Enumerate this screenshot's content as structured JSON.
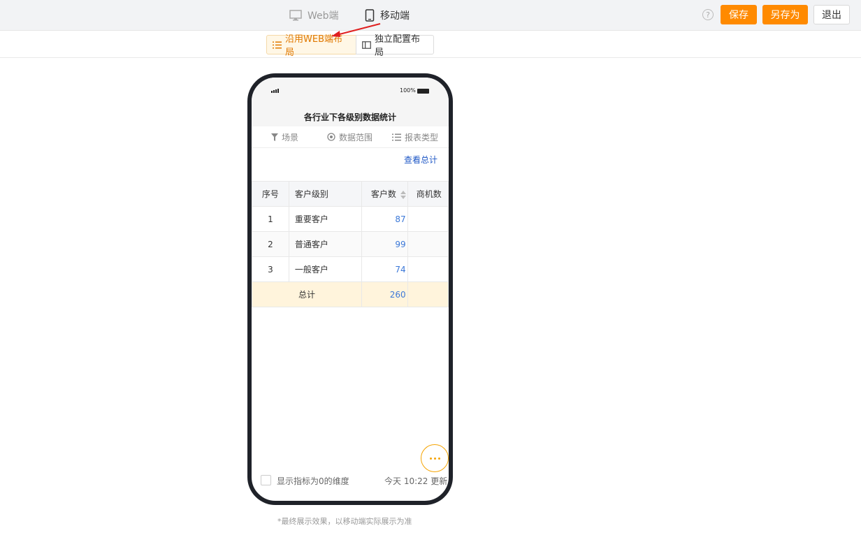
{
  "header": {
    "view_tabs": [
      {
        "label": "Web端",
        "icon": "monitor-icon",
        "active": false
      },
      {
        "label": "移动端",
        "icon": "mobile-icon",
        "active": true
      }
    ],
    "help_icon": "help-icon",
    "save_label": "保存",
    "save_as_label": "另存为",
    "exit_label": "退出",
    "accent_color": "#ff8a00"
  },
  "layout_bar": {
    "inherit_label": "沿用WEB端布局",
    "independent_label": "独立配置布局"
  },
  "phone": {
    "battery_label": "100%",
    "title": "各行业下各级别数据统计",
    "filters": [
      {
        "label": "场景",
        "icon": "filter-icon"
      },
      {
        "label": "数据范围",
        "icon": "scope-icon"
      },
      {
        "label": "报表类型",
        "icon": "list-icon"
      }
    ],
    "view_total_label": "查看总计",
    "table": {
      "headers": [
        "序号",
        "客户级别",
        "客户数",
        "商机数"
      ],
      "rows": [
        {
          "index": "1",
          "level": "重要客户",
          "count": "87"
        },
        {
          "index": "2",
          "level": "普通客户",
          "count": "99"
        },
        {
          "index": "3",
          "level": "一般客户",
          "count": "74"
        }
      ],
      "total": {
        "label": "总计",
        "count": "260"
      }
    },
    "show_zero_label": "显示指标为0的维度",
    "update_label": "今天 10:22 更新"
  },
  "footnote": "*最终展示效果，以移动端实际展示为准"
}
